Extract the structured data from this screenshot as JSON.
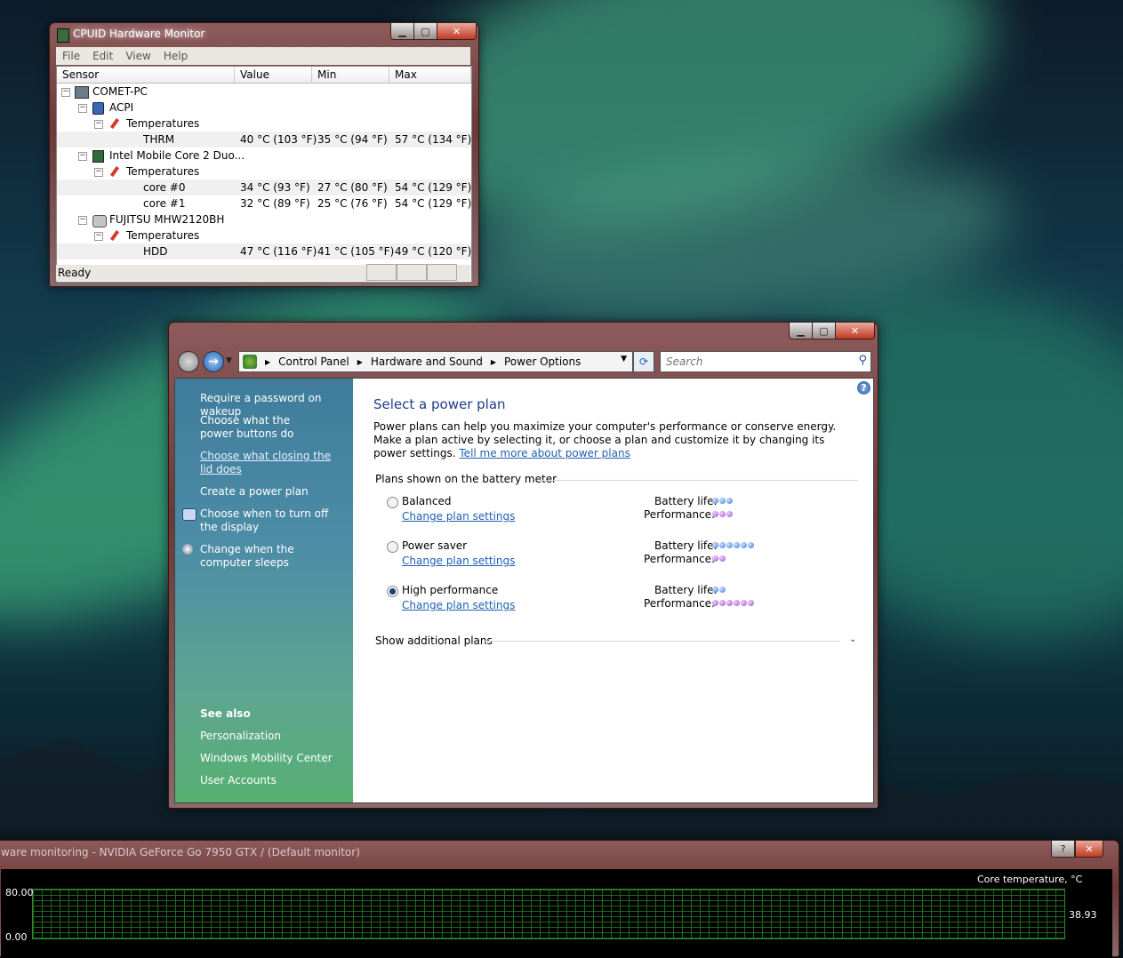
{
  "cpuid": {
    "title": "CPUID Hardware Monitor",
    "menu": [
      "File",
      "Edit",
      "View",
      "Help"
    ],
    "columns": [
      "Sensor",
      "Value",
      "Min",
      "Max"
    ],
    "rows": [
      {
        "label": "COMET-PC",
        "value": "",
        "min": "",
        "max": ""
      },
      {
        "label": "ACPI",
        "value": "",
        "min": "",
        "max": ""
      },
      {
        "label": "Temperatures",
        "value": "",
        "min": "",
        "max": ""
      },
      {
        "label": "THRM",
        "value": "40 °C  (103 °F)",
        "min": "35 °C  (94 °F)",
        "max": "57 °C  (134 °F)"
      },
      {
        "label": "Intel Mobile Core 2 Duo...",
        "value": "",
        "min": "",
        "max": ""
      },
      {
        "label": "Temperatures",
        "value": "",
        "min": "",
        "max": ""
      },
      {
        "label": "core #0",
        "value": "34 °C  (93 °F)",
        "min": "27 °C  (80 °F)",
        "max": "54 °C  (129 °F)"
      },
      {
        "label": "core #1",
        "value": "32 °C  (89 °F)",
        "min": "25 °C  (76 °F)",
        "max": "54 °C  (129 °F)"
      },
      {
        "label": "FUJITSU MHW2120BH",
        "value": "",
        "min": "",
        "max": ""
      },
      {
        "label": "Temperatures",
        "value": "",
        "min": "",
        "max": ""
      },
      {
        "label": "HDD",
        "value": "47 °C  (116 °F)",
        "min": "41 °C  (105 °F)",
        "max": "49 °C  (120 °F)"
      }
    ],
    "status": "Ready"
  },
  "control_panel": {
    "breadcrumb": [
      "Control Panel",
      "Hardware and Sound",
      "Power Options"
    ],
    "search_placeholder": "Search",
    "left_tasks": [
      "Require a password on wakeup",
      "Choose what the power buttons do",
      "Choose what closing the lid does",
      "Create a power plan",
      "Choose when to turn off the display",
      "Change when the computer sleeps"
    ],
    "see_also_heading": "See also",
    "see_also": [
      "Personalization",
      "Windows Mobility Center",
      "User Accounts"
    ],
    "page_title": "Select a power plan",
    "description": "Power plans can help you maximize your computer's performance or conserve energy. Make a plan active by selecting it, or choose a plan and customize it by changing its power settings. ",
    "tell_me_more": "Tell me more about power plans",
    "section_heading": "Plans shown on the battery meter",
    "battery_label": "Battery life:",
    "performance_label": "Performance:",
    "change_label": "Change plan settings",
    "plans": [
      {
        "name": "Balanced",
        "selected": false,
        "battery": 3,
        "performance": 3
      },
      {
        "name": "Power saver",
        "selected": false,
        "battery": 6,
        "performance": 2
      },
      {
        "name": "High performance",
        "selected": true,
        "battery": 2,
        "performance": 6
      }
    ],
    "show_additional": "Show additional plans"
  },
  "monitor": {
    "title": "ware monitoring - NVIDIA GeForce Go 7950 GTX / (Default monitor)",
    "y_max": "80.00",
    "y_min": "0.00",
    "series_label": "Core temperature, °C",
    "current_value": "38.93"
  },
  "colors": {
    "link": "#1f5fb3",
    "title_blue": "#1e3d8a",
    "battery_dot": "#3b78d8",
    "performance_dot": "#a04bd3"
  }
}
